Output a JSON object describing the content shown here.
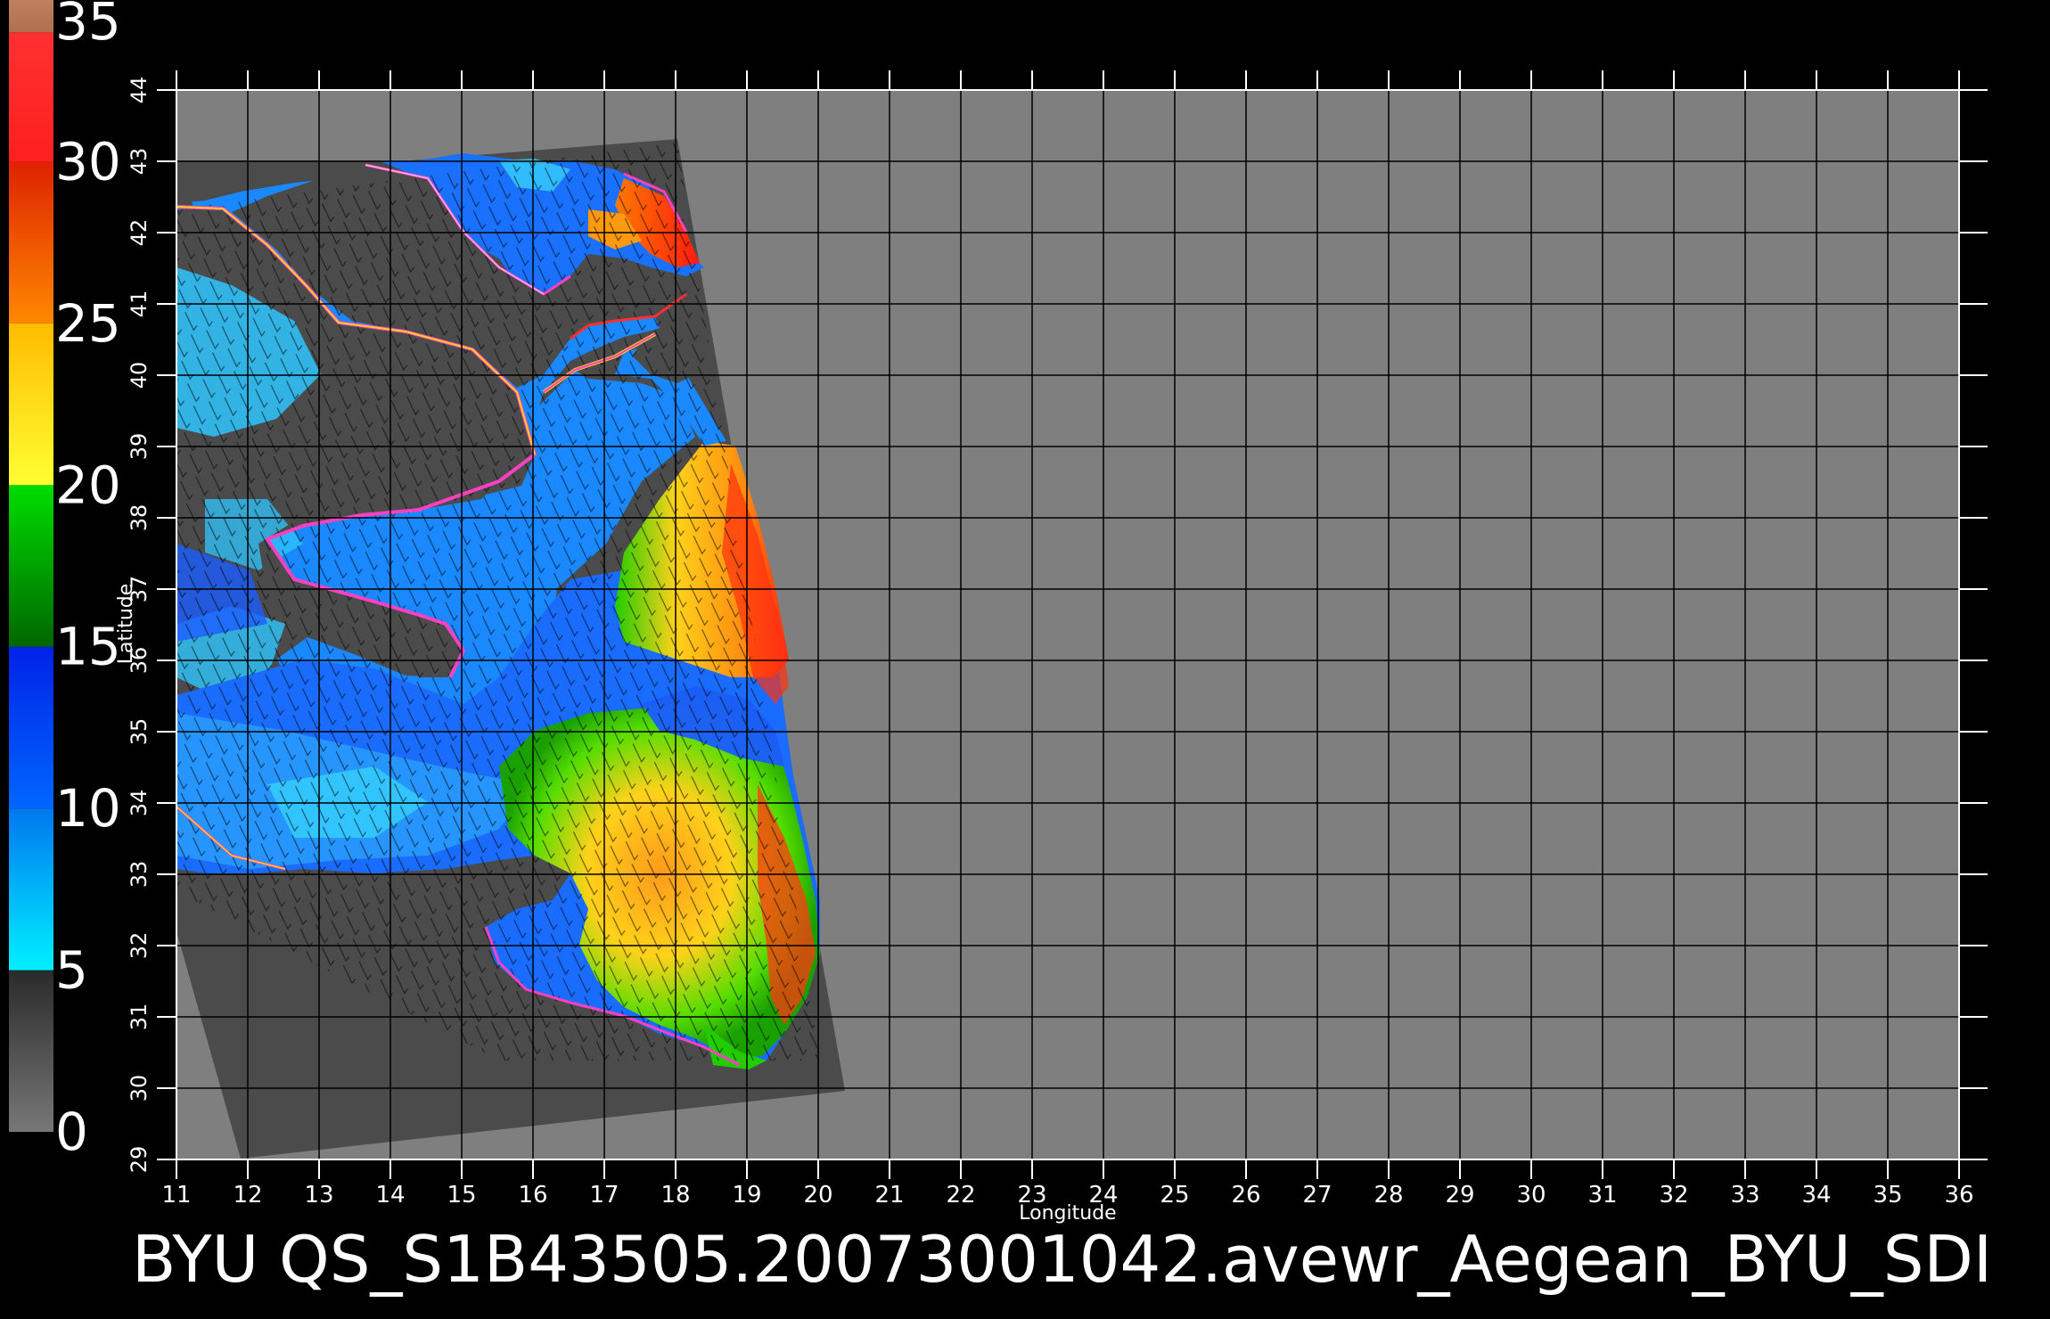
{
  "map": {
    "title": "BYU  QS_S1B43505.20073001042.avewr_Aegean_BYU_SDI",
    "xlabel": "Longitude",
    "ylabel": "Latitude",
    "lon_range": [
      11,
      36
    ],
    "lat_range": [
      29,
      44
    ],
    "lon_ticks": [
      "11",
      "12",
      "13",
      "14",
      "15",
      "16",
      "17",
      "18",
      "19",
      "20",
      "21",
      "22",
      "23",
      "24",
      "25",
      "26",
      "27",
      "28",
      "29",
      "30",
      "31",
      "32",
      "33",
      "34",
      "35",
      "36"
    ],
    "lat_ticks": [
      "29",
      "30",
      "31",
      "32",
      "33",
      "34",
      "35",
      "36",
      "37",
      "38",
      "39",
      "40",
      "41",
      "42",
      "43",
      "44"
    ],
    "background_color": "#7f7f7f",
    "land_color": "#4a4a4a",
    "grid_color": "#000000"
  },
  "colorbar": {
    "labels": [
      "35",
      "30",
      "25",
      "20",
      "15",
      "10",
      "5",
      "0"
    ],
    "values": [
      35,
      30,
      25,
      20,
      15,
      10,
      5,
      0
    ],
    "segments": [
      {
        "from": 0,
        "to": 5,
        "color_bottom": "#777777",
        "color_top": "#2a2a2a"
      },
      {
        "from": 5,
        "to": 10,
        "color_bottom": "#00f0ff",
        "color_top": "#0077ee"
      },
      {
        "from": 10,
        "to": 15,
        "color_bottom": "#0066ff",
        "color_top": "#0022e6"
      },
      {
        "from": 15,
        "to": 20,
        "color_bottom": "#006600",
        "color_top": "#00dd00"
      },
      {
        "from": 20,
        "to": 25,
        "color_bottom": "#ffff33",
        "color_top": "#ffbb00"
      },
      {
        "from": 25,
        "to": 30,
        "color_bottom": "#ff8800",
        "color_top": "#dd2200"
      },
      {
        "from": 30,
        "to": 34,
        "color_bottom": "#ff2020",
        "color_top": "#ff3030"
      },
      {
        "from": 34,
        "to": 35,
        "color_bottom": "#b07050",
        "color_top": "#c08060"
      }
    ]
  }
}
